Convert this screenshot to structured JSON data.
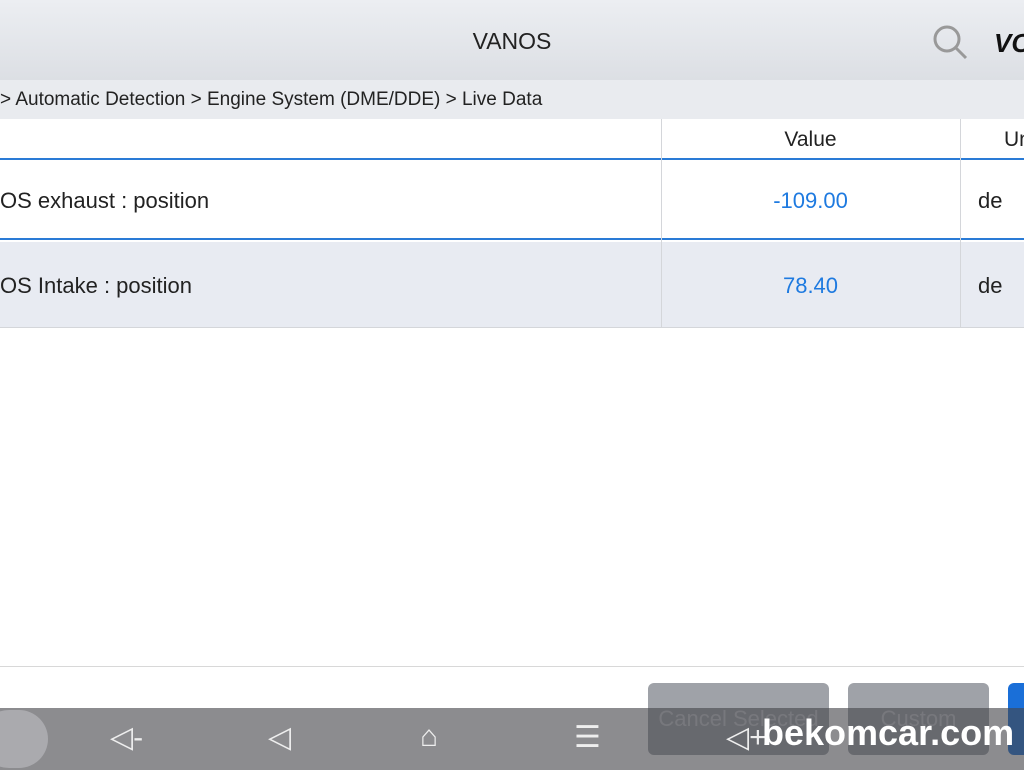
{
  "header": {
    "title": "VANOS",
    "logo": "VO",
    "search_icon": "search-icon"
  },
  "breadcrumb": "> Automatic Detection  > Engine System (DME/DDE) > Live Data",
  "table": {
    "columns": [
      "Value",
      "Un"
    ],
    "rows": [
      {
        "name": "OS exhaust : position",
        "value": "-109.00",
        "unit": "de"
      },
      {
        "name": "OS Intake : position",
        "value": "78.40",
        "unit": "de"
      }
    ]
  },
  "buttons": {
    "cancel": "Cancel Selected",
    "custom": "Custom"
  },
  "nav": {
    "vol_down": "◁-",
    "back": "◁",
    "home": "⌂",
    "menu": "☰",
    "vol_up": "◁+"
  },
  "watermark": "bekomcar.com",
  "colors": {
    "accent": "#1e7ae0"
  }
}
